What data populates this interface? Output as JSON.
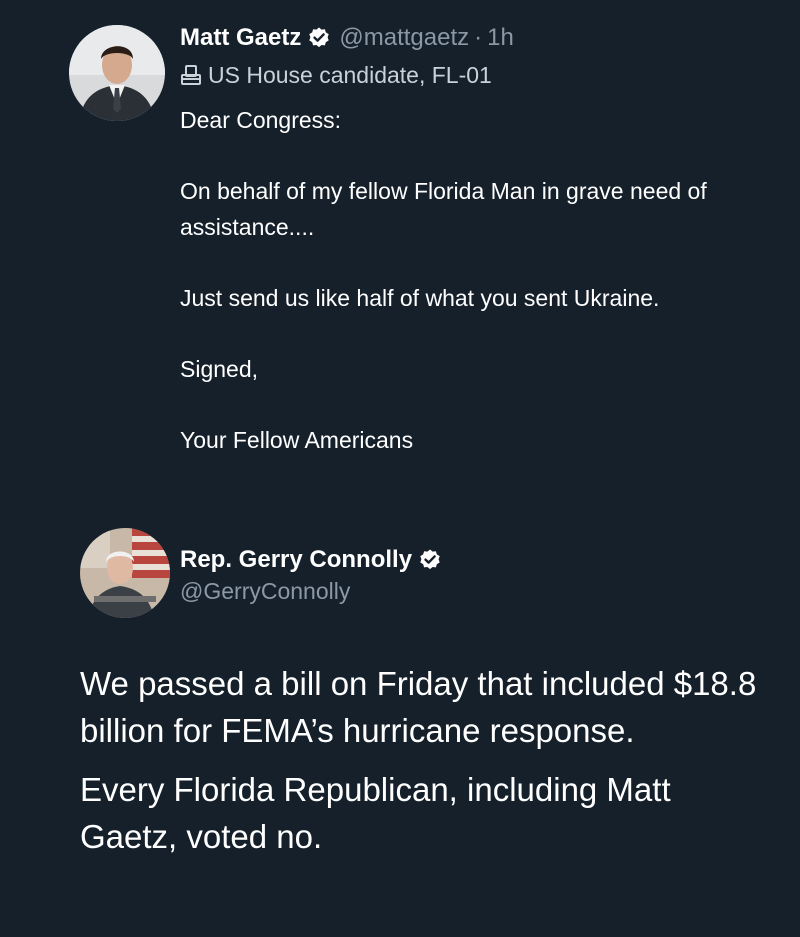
{
  "tweet_1": {
    "author_name": "Matt Gaetz",
    "handle": "@mattgaetz",
    "separator": "·",
    "time": "1h",
    "label_icon": "ballot-box-icon",
    "label": "US House candidate, FL-01",
    "verified_icon": "verified-badge-icon",
    "body": [
      "Dear Congress:",
      "On behalf of my fellow Florida Man in grave need of assistance....",
      "Just send us like half of what you sent Ukraine.",
      "Signed,",
      "Your Fellow Americans"
    ]
  },
  "tweet_2": {
    "author_name": "Rep. Gerry Connolly",
    "verified_icon": "verified-badge-icon",
    "handle": "@GerryConnolly",
    "body": [
      "We passed a bill on Friday that included $18.8 billion for FEMA’s hurricane response.",
      "Every Florida Republican, including Matt Gaetz, voted no."
    ]
  },
  "colors": {
    "background": "#15202b",
    "primary_text": "#ffffff",
    "secondary_text": "#8b98a5",
    "verified_badge": "#ffffff"
  }
}
